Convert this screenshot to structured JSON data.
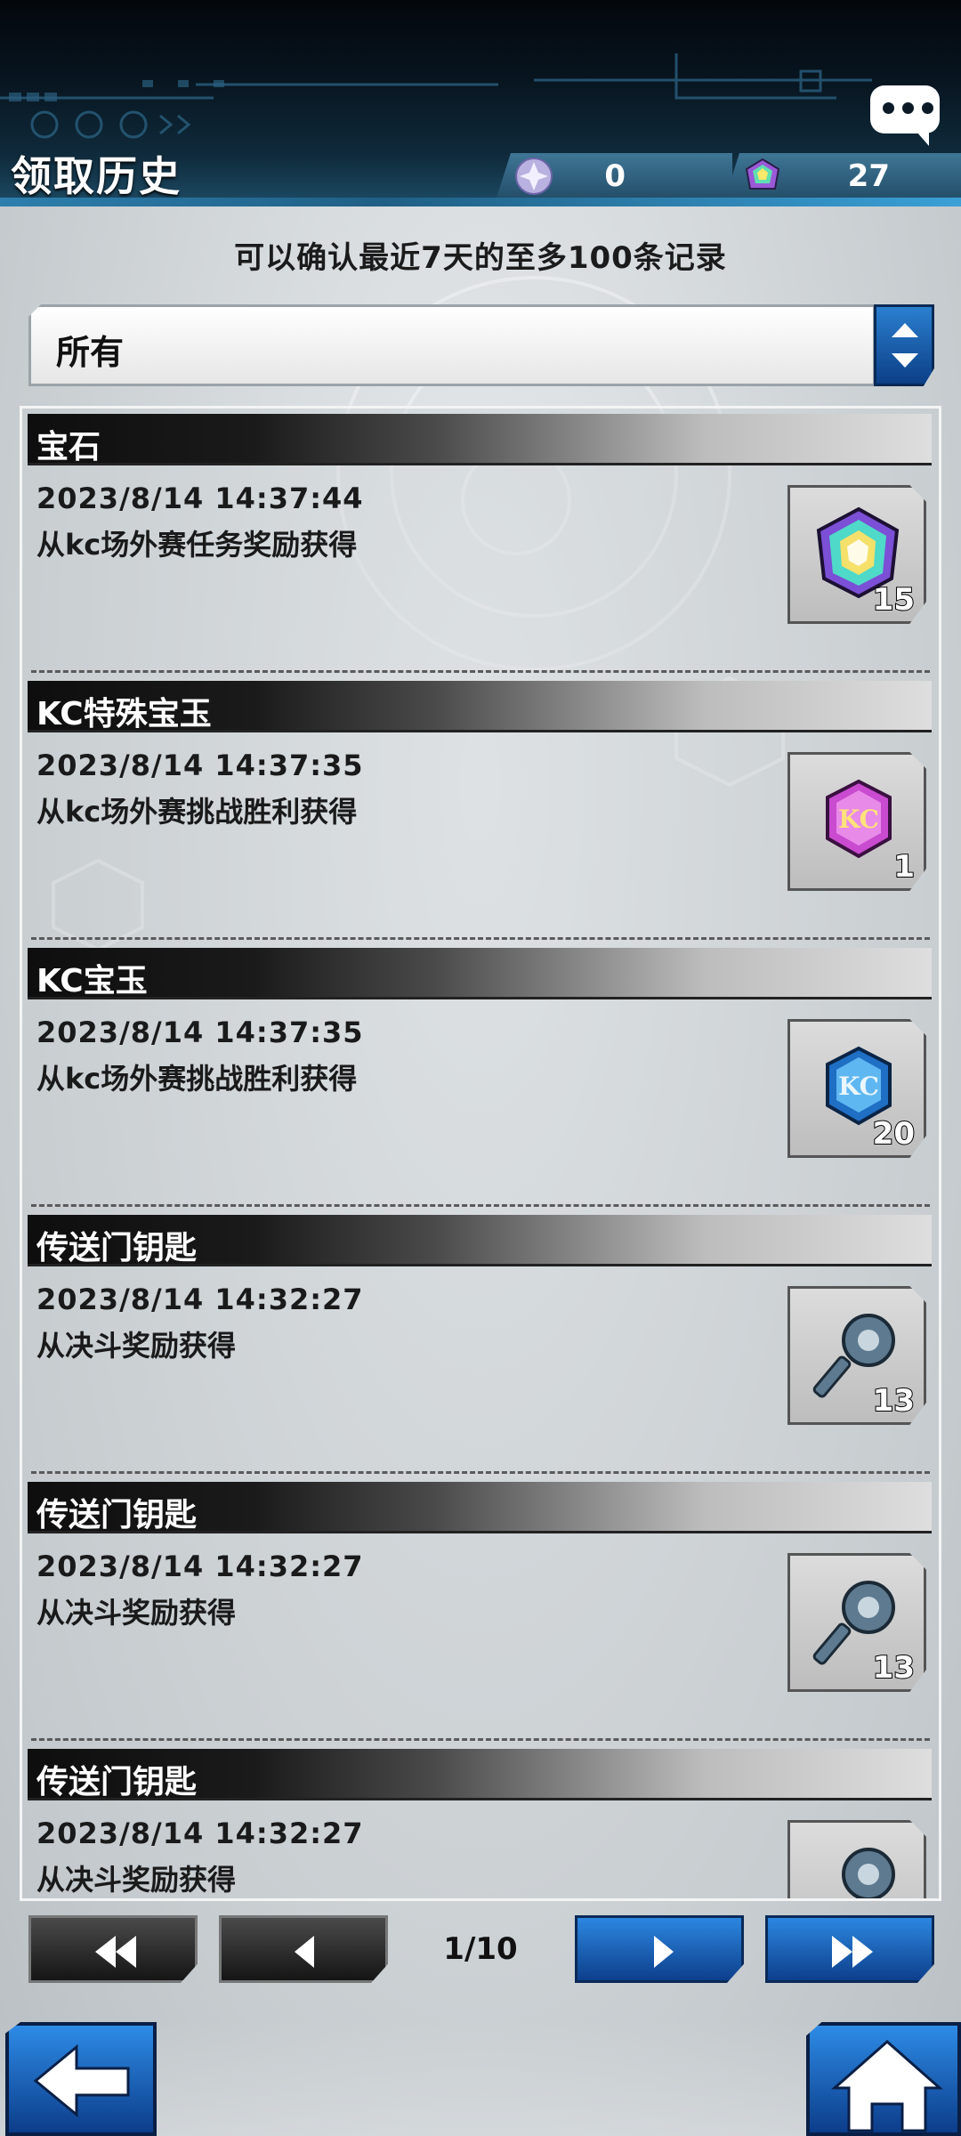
{
  "header": {
    "title": "领取历史",
    "currencies": [
      {
        "icon": "crystal-orb-icon",
        "value": "0"
      },
      {
        "icon": "gem-icon",
        "value": "27"
      }
    ]
  },
  "subtitle": "可以确认最近7天的至多100条记录",
  "filter": {
    "selected": "所有"
  },
  "entries": [
    {
      "category": "宝石",
      "date": "2023/8/14 14:37:44",
      "source": "从kc场外赛任务奖励获得",
      "icon": "rainbow-gem-icon",
      "count": "15"
    },
    {
      "category": "KC特殊宝玉",
      "date": "2023/8/14 14:37:35",
      "source": "从kc场外赛挑战胜利获得",
      "icon": "kc-special-orb-icon",
      "count": "1"
    },
    {
      "category": "KC宝玉",
      "date": "2023/8/14 14:37:35",
      "source": "从kc场外赛挑战胜利获得",
      "icon": "kc-orb-icon",
      "count": "20"
    },
    {
      "category": "传送门钥匙",
      "date": "2023/8/14 14:32:27",
      "source": "从决斗奖励获得",
      "icon": "gate-key-icon",
      "count": "13"
    },
    {
      "category": "传送门钥匙",
      "date": "2023/8/14 14:32:27",
      "source": "从决斗奖励获得",
      "icon": "gate-key-icon",
      "count": "13"
    },
    {
      "category": "传送门钥匙",
      "date": "2023/8/14 14:32:27",
      "source": "从决斗奖励获得",
      "icon": "gate-key-icon",
      "count": ""
    }
  ],
  "pager": {
    "indicator": "1/10"
  },
  "colors": {
    "accent_blue": "#1f6fc4",
    "header_dark": "#07131d"
  }
}
